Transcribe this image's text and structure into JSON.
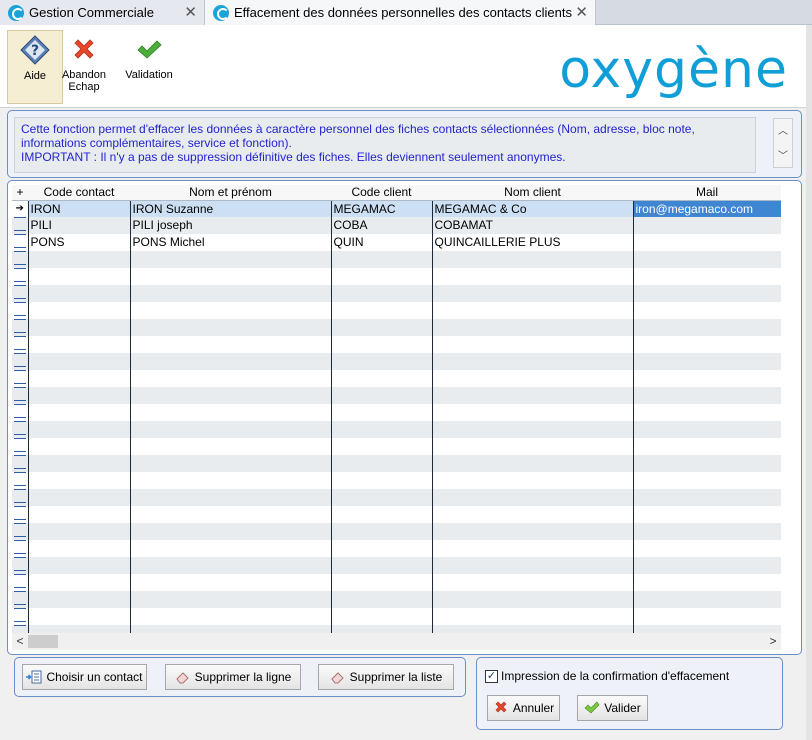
{
  "tabs": [
    {
      "label": "Gestion Commerciale",
      "close": "✕"
    },
    {
      "label": "Effacement des données personnelles des contacts clients",
      "close": "✕"
    }
  ],
  "toolbar": {
    "help_label": "Aide",
    "abort_label": "Abandon\nEchap",
    "validate_label": "Validation"
  },
  "brand": "oxygène",
  "info": {
    "line1": "Cette fonction permet d'effacer les données à caractère personnel des fiches contacts sélectionnées (Nom, adresse, bloc note, informations complémentaires, service et fonction).",
    "line2": "IMPORTANT : Il n'y a pas de suppression définitive des fiches. Elles deviennent seulement anonymes."
  },
  "grid": {
    "columns": [
      "Code contact",
      "Nom et prénom",
      "Code client",
      "Nom client",
      "Mail"
    ],
    "rows": [
      {
        "code": "IRON",
        "name": "IRON Suzanne",
        "client_code": "MEGAMAC",
        "client_name": "MEGAMAC & Co",
        "mail": "iron@megamaco.com"
      },
      {
        "code": "PILI",
        "name": "PILI joseph",
        "client_code": "COBA",
        "client_name": "COBAMAT",
        "mail": ""
      },
      {
        "code": "PONS",
        "name": "PONS Michel",
        "client_code": "QUIN",
        "client_name": "QUINCAILLERIE PLUS",
        "mail": ""
      }
    ]
  },
  "actions": {
    "choose_label": "Choisir un contact",
    "delete_line_label": "Supprimer la ligne",
    "delete_list_label": "Supprimer la liste"
  },
  "confirm": {
    "checkbox_label": "Impression de la confirmation d'effacement",
    "checked": true,
    "cancel_label": "Annuler",
    "validate_label": "Valider"
  },
  "colors": {
    "brand": "#0f9fd6",
    "info_text": "#2323cf",
    "selection": "#3e86d2"
  }
}
